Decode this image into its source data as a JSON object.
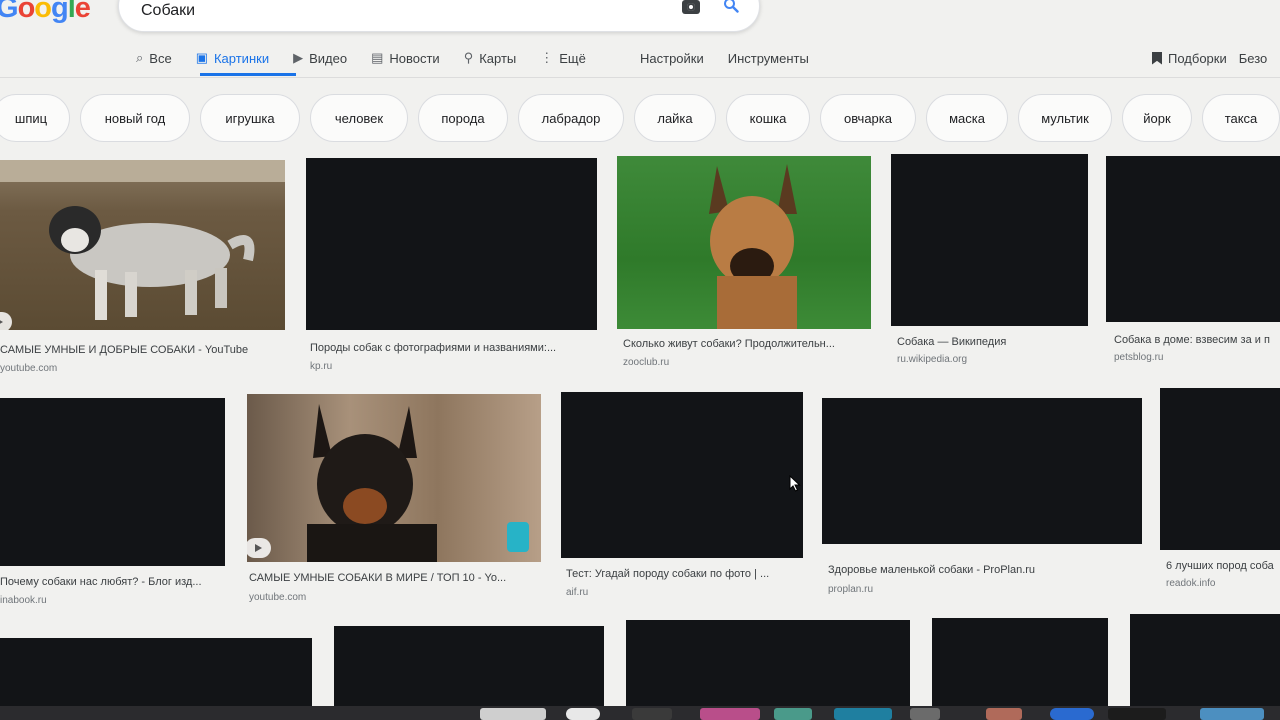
{
  "logo": [
    "G",
    "o",
    "o",
    "g",
    "l",
    "e"
  ],
  "search": {
    "value": "Собаки"
  },
  "icons": {
    "camera": "camera-icon",
    "search": "magnifier-icon"
  },
  "tabs": [
    {
      "label": "Все",
      "icon": "search-icon"
    },
    {
      "label": "Картинки",
      "icon": "image-icon"
    },
    {
      "label": "Видео",
      "icon": "play-icon"
    },
    {
      "label": "Новости",
      "icon": "news-icon"
    },
    {
      "label": "Карты",
      "icon": "pin-icon"
    },
    {
      "label": "Ещё",
      "icon": "more-dots-icon"
    }
  ],
  "tools": {
    "settings": "Настройки",
    "instruments": "Инструменты"
  },
  "header_right": {
    "collections": "Подборки",
    "safe": "Безо"
  },
  "chips": [
    "шпиц",
    "новый год",
    "игрушка",
    "человек",
    "порода",
    "лабрадор",
    "лайка",
    "кошка",
    "овчарка",
    "маска",
    "мультик",
    "йорк",
    "такса"
  ],
  "results": [
    {
      "title": "САМЫЕ УМНЫЕ И ДОБРЫЕ СОБАКИ - YouTube",
      "source": "youtube.com"
    },
    {
      "title": "Породы собак с фотографиями и названиями:...",
      "source": "kp.ru"
    },
    {
      "title": "Сколько живут собаки? Продолжительн...",
      "source": "zooclub.ru"
    },
    {
      "title": "Собака — Википедия",
      "source": "ru.wikipedia.org"
    },
    {
      "title": "Собака в доме: взвесим за и п",
      "source": "petsblog.ru"
    },
    {
      "title": "Почему собаки нас любят? - Блог изд...",
      "source": "inabook.ru"
    },
    {
      "title": "САМЫЕ УМНЫЕ СОБАКИ В МИРЕ / ТОП 10 - Yo...",
      "source": "youtube.com"
    },
    {
      "title": "Тест: Угадай породу собаки по фото | ...",
      "source": "aif.ru"
    },
    {
      "title": "Здоровье маленькой собаки - ProPlan.ru",
      "source": "proplan.ru"
    },
    {
      "title": "6 лучших пород соба",
      "source": "readok.info"
    }
  ],
  "colors": {
    "accent": "#1a73e8",
    "thumb_dark": "#121417"
  }
}
